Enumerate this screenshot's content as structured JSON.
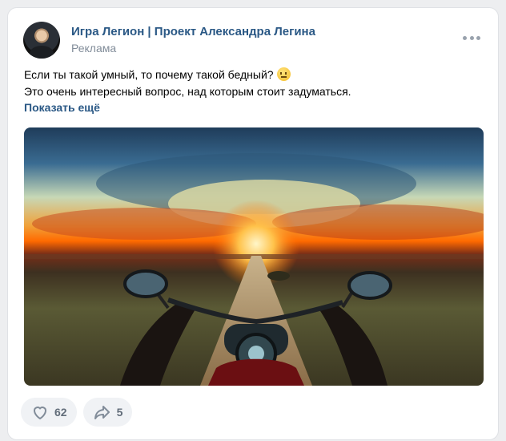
{
  "post": {
    "author": "Игра Легион | Проект Александра Легина",
    "subtitle": "Реклама",
    "text_line1": "Если ты такой умный, то почему такой бедный?",
    "text_line2": "Это очень интересный вопрос, над которым стоит задуматься.",
    "show_more": "Показать ещё",
    "emoji": "neutral-face-emoji"
  },
  "actions": {
    "likes": "62",
    "shares": "5"
  },
  "icons": {
    "more": "more-horizontal-icon",
    "like": "heart-icon",
    "share": "share-arrow-icon"
  },
  "colors": {
    "link": "#2a5885",
    "muted": "#818c99",
    "pill_bg": "#f0f2f5",
    "page_bg": "#edeef0"
  }
}
